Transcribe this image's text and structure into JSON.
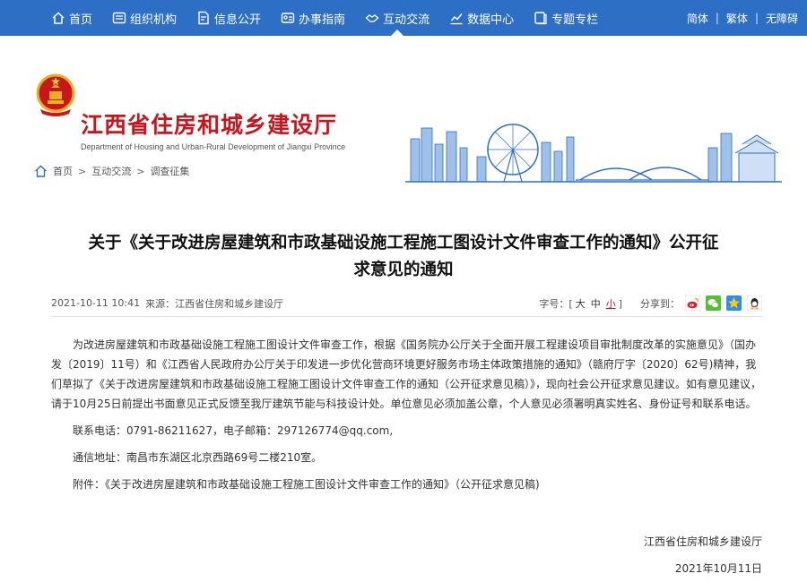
{
  "nav": {
    "items": [
      {
        "label": "首页",
        "icon": "home-icon"
      },
      {
        "label": "组织机构",
        "icon": "org-icon"
      },
      {
        "label": "信息公开",
        "icon": "document-icon"
      },
      {
        "label": "办事指南",
        "icon": "id-card-icon"
      },
      {
        "label": "互动交流",
        "icon": "handshake-icon"
      },
      {
        "label": "数据中心",
        "icon": "chart-icon"
      },
      {
        "label": "专题专栏",
        "icon": "folder-icon"
      }
    ],
    "lang": [
      "简体",
      "繁体",
      "无障碍"
    ]
  },
  "site": {
    "title": "江西省住房和城乡建设厅",
    "subtitle": "Department of Housing and Urban-Rural Development of Jiangxi Province"
  },
  "breadcrumb": [
    "首页",
    "互动交流",
    "调查征集"
  ],
  "article": {
    "title_line1": "关于《关于改进房屋建筑和市政基础设施工程施工图设计文件审查工作的通知》公开征",
    "title_line2": "求意见的通知",
    "date": "2021-10-11 10:41",
    "source": "来源：江西省住房和城乡建设厅",
    "fontsize_label": "字号：",
    "fontsize_open": "[",
    "fontsize_large": "大",
    "fontsize_mid": "中",
    "fontsize_small": "小",
    "fontsize_close": "]",
    "share_label": "分享到：",
    "paragraph": "为改进房屋建筑和市政基础设施工程施工图设计文件审查工作，根据《国务院办公厅关于全面开展工程建设项目审批制度改革的实施意见》（国办发〔2019〕11号）和《江西省人民政府办公厅关于印发进一步优化营商环境更好服务市场主体政策措施的通知》（赣府厅字〔2020〕62号)精神，我们草拟了《关于改进房屋建筑和市政基础设施工程施工图设计文件审查工作的通知（公开征求意见稿）》，现向社会公开征求意见建议。如有意见建议，请于10月25日前提出书面意见正式反馈至我厅建筑节能与科技设计处。单位意见必须加盖公章，个人意见必须署明真实姓名、身份证号和联系电话。",
    "contact": "联系电话：0791-86211627，电子邮箱：297126774@qq.com,",
    "address": "通信地址：南昌市东湖区北京西路69号二楼210室。",
    "attachment": "附件：《关于改进房屋建筑和市政基础设施工程施工图设计文件审查工作的通知》（公开征求意见稿)",
    "signer": "江西省住房和城乡建设厅",
    "sign_date": "2021年10月11日"
  },
  "colors": {
    "nav_bg": "#2e6fc6",
    "title_red": "#c8161d"
  }
}
